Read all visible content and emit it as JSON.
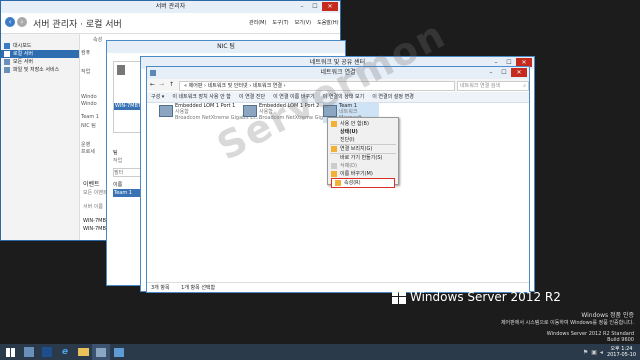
{
  "server_manager": {
    "title": "서버 관리자",
    "header": "서버 관리자 · 로컬 서버",
    "menu": [
      "관리(M)",
      "도구(T)",
      "보기(V)",
      "도움말(H)"
    ],
    "sidebar": [
      "대시보드",
      "로컬 서버",
      "모든 서버",
      "파일 및 저장소 서비스"
    ],
    "partial": [
      "속성",
      "컴퓨",
      "작업",
      "Windo",
      "Windo",
      "Team 1",
      "NIC 팀",
      "운영",
      "프로세"
    ],
    "events_title": "이벤트",
    "events_sub": "모든 이벤트 | 총",
    "event_rows": [
      "서버 이름",
      "WIN-7MBT",
      "WIN-7MBT"
    ]
  },
  "nic_team": {
    "title": "NIC 팀",
    "list_header": "이름",
    "rows": [
      "WIN-7MBT",
      "Team 1"
    ],
    "section1": "팀",
    "section2": "작업",
    "filter": "필터"
  },
  "network_center": {
    "title": "네트워크 및 공유 센터"
  },
  "network_connections": {
    "title": "네트워크 연결",
    "breadcrumb": "« 제어판 › 네트워크 및 인터넷 › 네트워크 연결 ›",
    "search_placeholder": "네트워크 연결 검색",
    "toolbar": [
      "구성 ▾",
      "이 네트워크 장치 사용 안 함",
      "이 연결 진단",
      "이 연결 이름 바꾸기",
      "이 연결의 상태 보기",
      "이 연결의 설정 변경"
    ],
    "adapters": [
      {
        "name": "Embedded LOM 1 Port 1",
        "status": "사용함",
        "device": "Broadcom NetXtreme Gigabit Et..."
      },
      {
        "name": "Embedded LOM 1 Port 2",
        "status": "사용함",
        "device": "Broadcom NetXtreme Gigabit Et..."
      },
      {
        "name": "Team 1",
        "status": "네트워크",
        "device": "Microsoft..."
      }
    ],
    "status_items": "3개 항목",
    "status_selected": "1개 항목 선택함"
  },
  "context_menu": {
    "items": [
      "사용 안 함(B)",
      "상태(U)",
      "진단(I)",
      "연결 브리지(G)",
      "바로 가기 만들기(S)",
      "삭제(D)",
      "이름 바꾸기(M)",
      "속성(R)"
    ],
    "highlight_color": "#d9302a"
  },
  "branding": {
    "product": "Windows Server 2012 R2",
    "watermark": "Servermon",
    "activation_title": "Windows 정품 인증",
    "activation_body": "제어판에서 시스템으로 이동하여 Windows를 정품 인증합니다.",
    "edition": "Windows Server 2012 R2 Standard",
    "build": "Build 9600"
  },
  "taskbar": {
    "time": "오후 1:24",
    "date": "2017-05-10"
  }
}
